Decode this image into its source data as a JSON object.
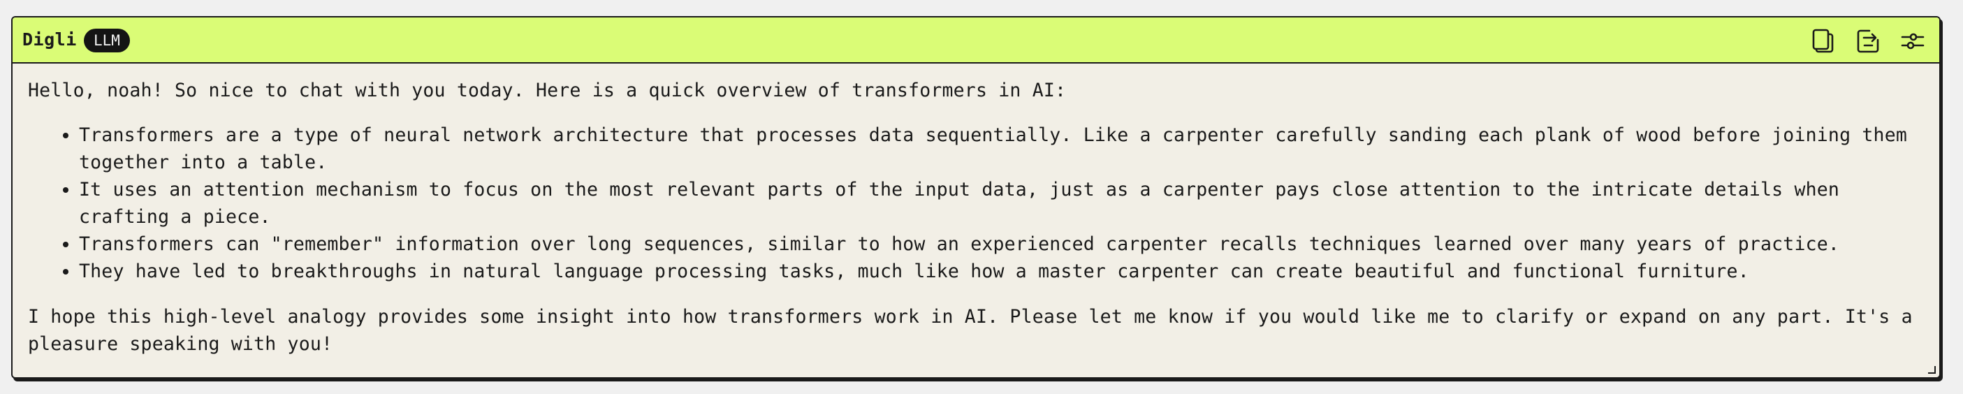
{
  "header": {
    "app_name": "Digli",
    "badge": "LLM",
    "actions": [
      {
        "icon": "copy-icon"
      },
      {
        "icon": "export-icon"
      },
      {
        "icon": "sliders-icon"
      }
    ]
  },
  "message": {
    "intro": "Hello, noah! So nice to chat with you today. Here is a quick overview of transformers in AI:",
    "bullets": [
      "Transformers are a type of neural network architecture that processes data sequentially. Like a carpenter carefully sanding each plank of wood before joining them together into a table.",
      "It uses an attention mechanism to focus on the most relevant parts of the input data, just as a carpenter pays close attention to the intricate details when crafting a piece.",
      "Transformers can \"remember\" information over long sequences, similar to how an experienced carpenter recalls techniques learned over many years of practice.",
      "They have led to breakthroughs in natural language processing tasks, much like how a master carpenter can create beautiful and functional furniture."
    ],
    "closing": "I hope this high-level analogy provides some insight into how transformers work in AI. Please let me know if you would like me to clarify or expand on any part. It's a pleasure speaking with you!"
  },
  "colors": {
    "header_bg": "#dafc76",
    "panel_bg": "#f2efe6",
    "badge_bg": "#141414",
    "border": "#1a1a1a"
  }
}
